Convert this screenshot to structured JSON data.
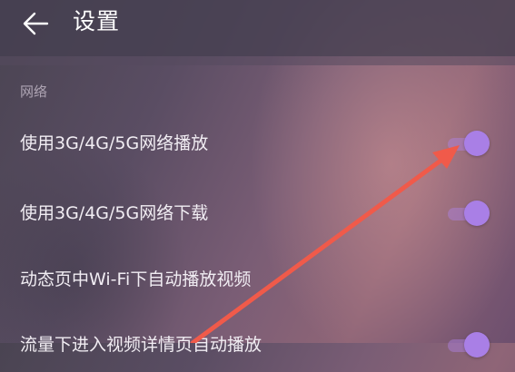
{
  "header": {
    "title": "设置",
    "back_icon": "arrow-left-icon"
  },
  "section": {
    "title": "网络"
  },
  "settings": [
    {
      "label": "使用3G/4G/5G网络播放",
      "toggle_on": true
    },
    {
      "label": "使用3G/4G/5G网络下载",
      "toggle_on": true
    },
    {
      "label": "动态页中Wi-Fi下自动播放视频"
    },
    {
      "label": "流量下进入视频详情页自动播放",
      "toggle_on": true
    }
  ],
  "colors": {
    "accent": "#a97fe6",
    "annotation_arrow": "#f05a4a"
  }
}
